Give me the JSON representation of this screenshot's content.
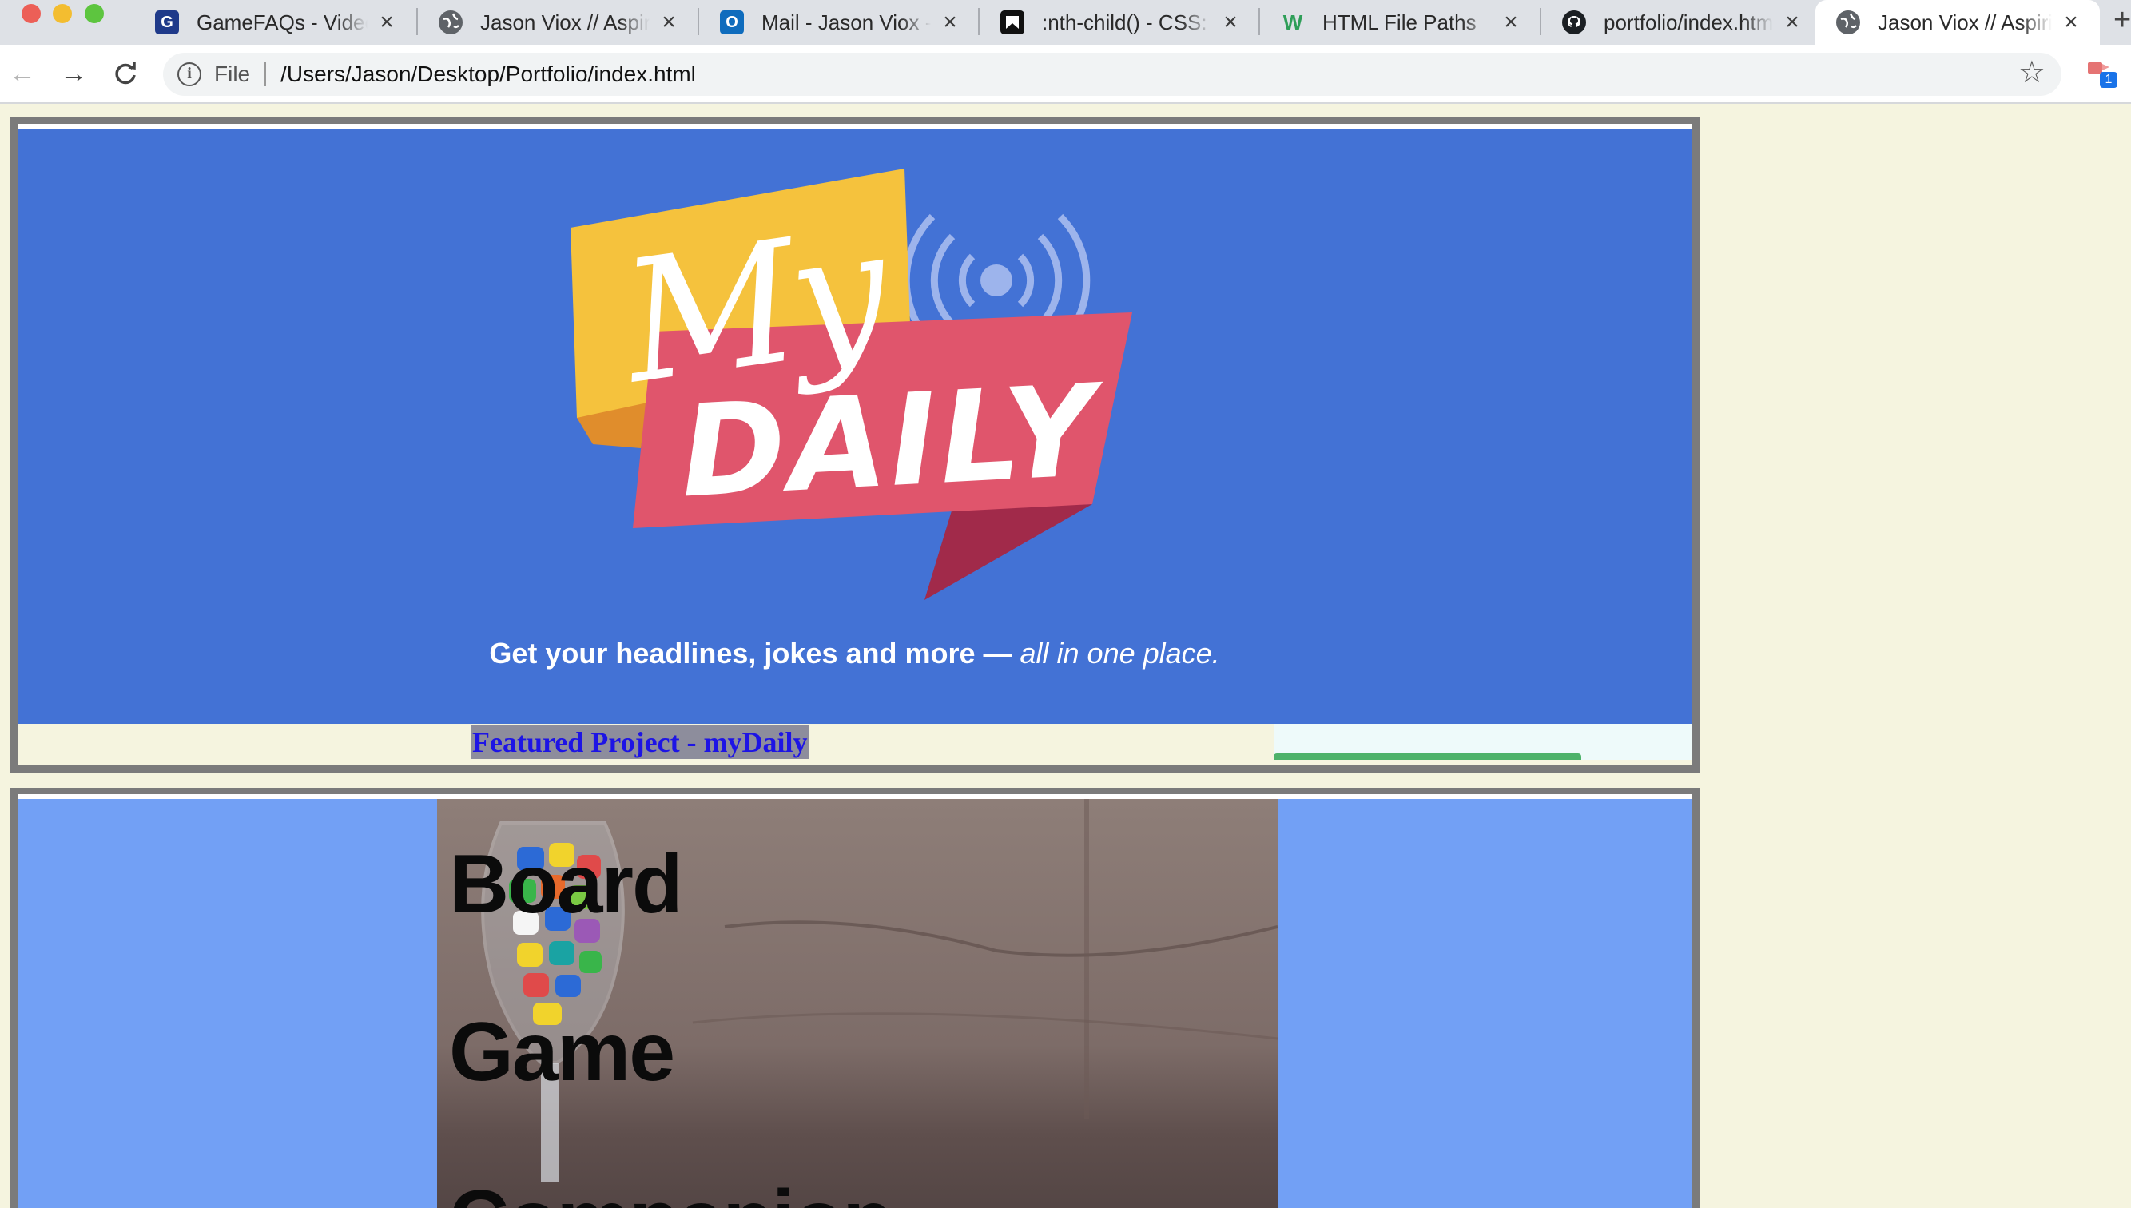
{
  "browser": {
    "tabs": [
      {
        "title": "GameFAQs - Video Games",
        "icon": "gamefaqs-icon",
        "active": false
      },
      {
        "title": "Jason Viox // Aspiring",
        "icon": "globe-icon",
        "active": false
      },
      {
        "title": "Mail - Jason Viox - Outlook",
        "icon": "outlook-icon",
        "active": false
      },
      {
        "title": ":nth-child() - CSS: Cascading",
        "icon": "mdn-icon",
        "active": false
      },
      {
        "title": "HTML File Paths",
        "icon": "w3schools-icon",
        "active": false
      },
      {
        "title": "portfolio/index.html",
        "icon": "github-icon",
        "active": false
      },
      {
        "title": "Jason Viox // Aspiring",
        "icon": "globe-icon",
        "active": true
      }
    ],
    "address": {
      "scheme_label": "File",
      "url": "/Users/Jason/Desktop/Portfolio/index.html"
    },
    "extension_badge": "1"
  },
  "projects": [
    {
      "logo_word_script": "My",
      "logo_word_main": "DAILY",
      "tagline_plain": "Get your headlines, jokes and more —",
      "tagline_emphasis": "all in one place.",
      "caption": "Featured Project - myDaily"
    },
    {
      "title_lines": [
        "Board",
        "Game",
        "Companion"
      ]
    }
  ],
  "colors": {
    "hero_blue": "#4372d5",
    "hero2_blue": "#72a0f5",
    "logo_yellow": "#f5c23d",
    "logo_red": "#e0556c",
    "caption_text": "#1d14e5",
    "page_bg": "#f5f4df"
  }
}
